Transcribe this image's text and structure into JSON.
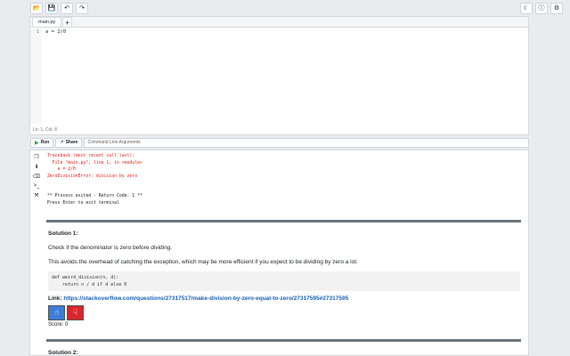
{
  "toolbar": {
    "left_icons": [
      "folder-open-icon",
      "save-icon",
      "undo-icon",
      "redo-icon"
    ],
    "right_icons": [
      "moon-icon",
      "info-icon",
      "settings-icon"
    ]
  },
  "editor": {
    "tab_label": "main.py",
    "add_tab": "+",
    "line_number": "1",
    "code": "a = 2/0",
    "status": "Ln: 1,  Col: 8"
  },
  "runbar": {
    "run_label": "Run",
    "share_label": "Share",
    "args_placeholder": "Command Line Arguments"
  },
  "terminal": {
    "error_lines": [
      "Traceback (most recent call last):",
      "  File \"main.py\", line 1, in <module>",
      "    a = 2/0",
      "ZeroDivisionError: division by zero"
    ],
    "output_lines": [
      "** Process exited - Return Code: 1 **",
      "Press Enter to exit terminal"
    ]
  },
  "solutions": [
    {
      "title": "Solution 1:",
      "text1": "Check if the denominator is zero before dividing.",
      "text2": "This avoids the overhead of catching the exception, which may be more efficient if you expect to be dividing by zero a lot.",
      "code": "def weird_division(n, d):\n    return n / d if d else 0",
      "link_label": "Link:",
      "link_url": "https://stackoverflow.com/questions/27317517/make-division-by-zero-equal-to-zero/27317595#27317595",
      "score_label": "Score: 0"
    },
    {
      "title": "Solution 2:"
    }
  ],
  "colors": {
    "error": "#e2231a",
    "link": "#1a61b8",
    "upvote": "#3a7dd8",
    "downvote": "#d9252d",
    "run_icon": "#28a745"
  }
}
